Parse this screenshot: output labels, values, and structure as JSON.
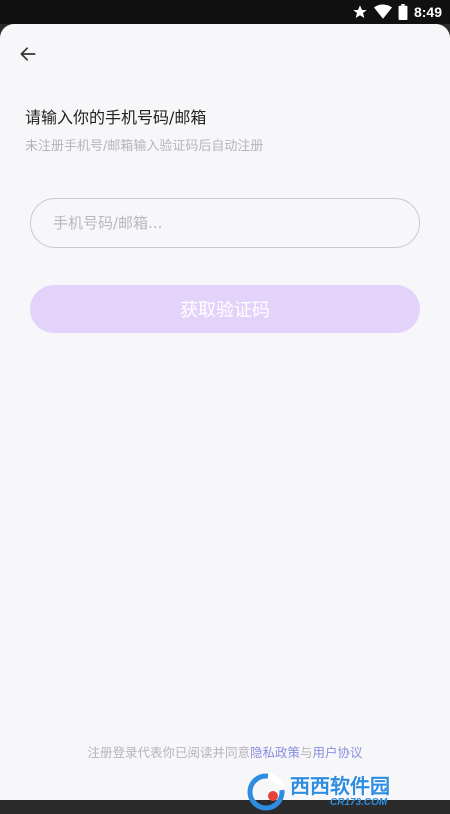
{
  "status_bar": {
    "time": "8:49",
    "icons": [
      "star-icon",
      "wifi-icon",
      "battery-icon"
    ]
  },
  "header": {
    "back_icon": "arrow-left-icon"
  },
  "login": {
    "title": "请输入你的手机号码/邮箱",
    "subtitle": "未注册手机号/邮箱输入验证码后自动注册",
    "input": {
      "placeholder": "手机号码/邮箱...",
      "value": ""
    },
    "get_code_label": "获取验证码"
  },
  "agreement": {
    "prefix": "注册登录代表你已阅读并同意",
    "privacy_link": "隐私政策",
    "conjunction": "与",
    "terms_link": "用户协议"
  },
  "watermark": {
    "brand": "西西软件园",
    "url": "CR173.COM"
  },
  "colors": {
    "accent": "#e3d3fb",
    "link": "#8a8ee0",
    "background": "#f7f6f8"
  }
}
